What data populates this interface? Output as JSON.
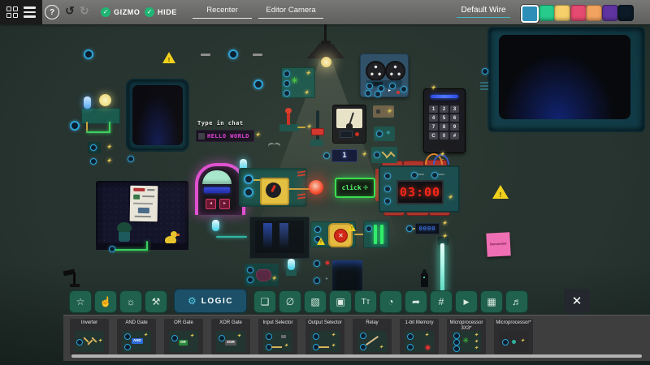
{
  "topbar": {
    "help_glyph": "?",
    "undo_glyph": "↺",
    "redo_glyph": "↻",
    "check_glyph": "✓",
    "gizmo_label": "GIZMO",
    "hide_label": "HIDE",
    "recenter_label": "Recenter",
    "editor_camera_label": "Editor Camera",
    "default_wire_label": "Default Wire",
    "wire_colors": [
      "#2d8fb8",
      "#27cc8c",
      "#f7cf6a",
      "#e54a70",
      "#f2a35f",
      "#5f34a0",
      "#0b1a26"
    ],
    "selected_wire_index": 0
  },
  "icons": {
    "diamond_node": "✦",
    "warning": "!",
    "x_mark": "✕",
    "click_cursor": "✛",
    "play": "▸",
    "green_star": "✳",
    "small_arrow": "➤"
  },
  "canvas": {
    "chat_prompt": "Type in chat",
    "chat_message": "HELLO WORLD",
    "click_sign_label": "click",
    "bomb_time": "03:00",
    "counter_value": "1",
    "mini_display_value": "0000",
    "keypad": {
      "keys": [
        "1",
        "2",
        "3",
        "4",
        "5",
        "6",
        "7",
        "8",
        "9",
        "C",
        "0",
        "#"
      ]
    },
    "sticky_note_text": "Remember",
    "jukebox_prev_glyph": "◂",
    "jukebox_next_glyph": "▸"
  },
  "bottombar": {
    "tabs": [
      {
        "name": "favorites",
        "glyph": "☆"
      },
      {
        "name": "interact",
        "glyph": "☝"
      },
      {
        "name": "lighting",
        "glyph": "☼"
      },
      {
        "name": "tools",
        "glyph": "⚒"
      },
      {
        "name": "logic",
        "glyph": "⚙",
        "label": "LOGIC"
      },
      {
        "name": "framing",
        "glyph": "❏"
      },
      {
        "name": "hidden",
        "glyph": "∅"
      },
      {
        "name": "images",
        "glyph": "▧"
      },
      {
        "name": "screens",
        "glyph": "▣"
      },
      {
        "name": "text",
        "glyph": "Tт"
      },
      {
        "name": "timers",
        "glyph": "◔"
      },
      {
        "name": "export",
        "glyph": "➦"
      },
      {
        "name": "numbers",
        "glyph": "#"
      },
      {
        "name": "video",
        "glyph": "▶"
      },
      {
        "name": "displays",
        "glyph": "▦"
      },
      {
        "name": "audio",
        "glyph": "♬"
      }
    ],
    "close_glyph": "✕",
    "items": [
      {
        "label": "Inverter"
      },
      {
        "label": "AND Gate",
        "chip": "AND"
      },
      {
        "label": "OR Gate",
        "chip": "OR"
      },
      {
        "label": "XOR Gate",
        "chip": "XOR"
      },
      {
        "label": "Input Selector"
      },
      {
        "label": "Output Selector"
      },
      {
        "label": "Relay"
      },
      {
        "label": "1-bit Memory"
      },
      {
        "label": "Microprocessor 3X3*"
      },
      {
        "label": "Microprocessor*"
      }
    ]
  }
}
